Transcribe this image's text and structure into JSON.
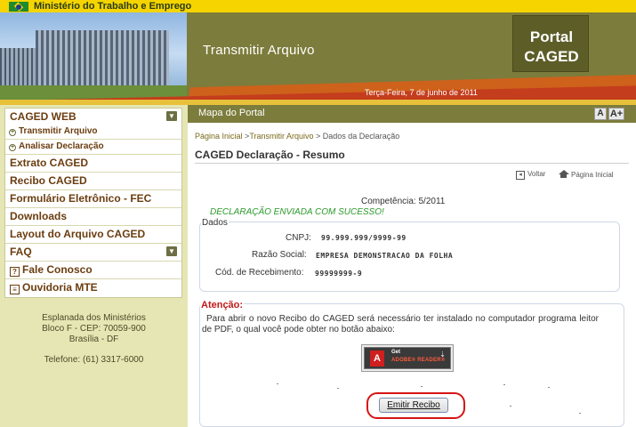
{
  "govbar": {
    "ministry": "Ministério do Trabalho e Emprego"
  },
  "header": {
    "page_heading": "Transmitir Arquivo",
    "date": "Terça-Feira, 7 de junho de 2011",
    "portal_line1": "Portal",
    "portal_line2": "CAGED"
  },
  "sidebar": {
    "caged_web": "CAGED WEB",
    "sub_items": [
      "Transmitir Arquivo",
      "Analisar Declaração"
    ],
    "items": [
      "Extrato CAGED",
      "Recibo CAGED",
      "Formulário Eletrônico - FEC",
      "Downloads",
      "Layout do Arquivo CAGED"
    ],
    "faq": "FAQ",
    "fale_conosco": "Fale Conosco",
    "ouvidoria": "Ouvidoria MTE",
    "address_line1": "Esplanada dos Ministérios",
    "address_line2": "Bloco F - CEP: 70059-900",
    "address_line3": "Brasília - DF",
    "phone": "Telefone: (61) 3317-6000"
  },
  "mapa_bar": {
    "label": "Mapa do Portal",
    "font_small": "A",
    "font_large": "A+"
  },
  "content": {
    "breadcrumb_home": "Página Inicial",
    "breadcrumb_sep1": " >",
    "breadcrumb_transmitir": "Transmitir Arquivo",
    "breadcrumb_rest": " > Dados da Declaração",
    "title": "CAGED Declaração - Resumo",
    "voltar": "Voltar",
    "pagina_inicial": "Página Inicial",
    "competencia": "Competência: 5/2011",
    "success": "DECLARAÇÃO ENVIADA COM SUCESSO!",
    "dados_legend": "Dados",
    "cnpj_label": "CNPJ:",
    "cnpj_value": "99.999.999/9999-99",
    "razao_label": "Razão Social:",
    "razao_value": "EMPRESA DEMONSTRACAO DA FOLHA",
    "recebimento_label": "Cód. de Recebimento:",
    "recebimento_value": "99999999-9",
    "atencao_title": "Atenção:",
    "atencao_text": "Para abrir o novo Recibo do CAGED será necessário ter instalado no computador programa leitor de PDF, o qual você pode obter no botão abaixo:",
    "adobe_get": "Get",
    "adobe_product": "ADOBE® READER®",
    "emitir_button": "Emitir Recibo"
  },
  "colors": {
    "olive": "#7c7c3c",
    "menu_text": "#6b3d10",
    "success_green": "#2a9a2a",
    "attention_red": "#c01818"
  }
}
